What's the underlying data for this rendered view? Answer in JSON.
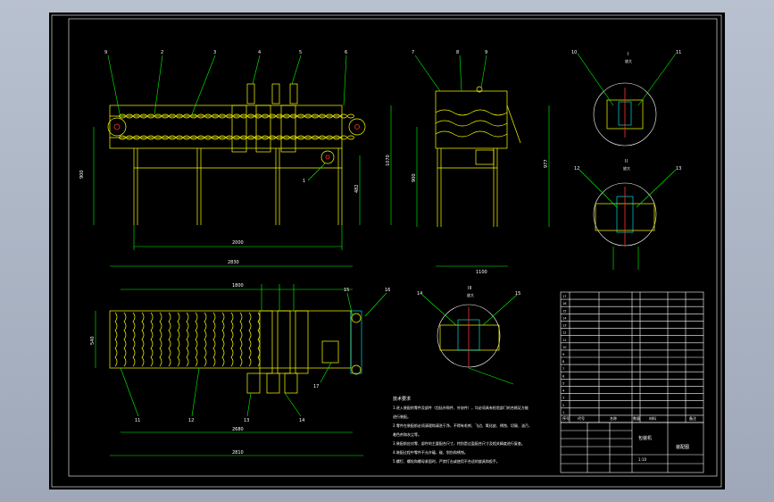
{
  "colors": {
    "sheet": "#000000",
    "frame": "#ffffff",
    "part": "#ffff00",
    "dim": "#00ff00",
    "center": "#ff3030",
    "hidden": "#00ffff"
  },
  "front_view": {
    "balloons": [
      "9",
      "2",
      "3",
      "4",
      "5",
      "6",
      "1"
    ],
    "dims": {
      "overall": "2830",
      "inner": "2000",
      "height_left": "900",
      "height_right": "850",
      "height_mid": "482",
      "height_top": "1070"
    }
  },
  "side_view": {
    "balloons": [
      "7",
      "8",
      "9"
    ],
    "dims": {
      "height": "977",
      "width": "1100",
      "height_left": "900"
    }
  },
  "detail_a": {
    "title": "I",
    "subtitle": "放大",
    "balloons": [
      "10",
      "11"
    ]
  },
  "detail_b": {
    "title": "II",
    "subtitle": "放大",
    "balloons": [
      "12",
      "13"
    ]
  },
  "detail_c": {
    "title": "III",
    "subtitle": "放大",
    "balloons": [
      "14",
      "15"
    ]
  },
  "top_view": {
    "balloons": [
      "11",
      "12",
      "13",
      "14",
      "15",
      "16",
      "17"
    ],
    "dims": {
      "length": "1800",
      "total": "2680",
      "overall": "2810",
      "width": "540"
    }
  },
  "tech_requirements": {
    "title": "技术要求",
    "lines": [
      "1.进入装配的零件及部件（包括外购件、外协件），均必须具有检验部门的合格证方能",
      "进行装配。",
      "2.零件在装配前必须清理和清洗干净，不得有毛刺、飞边、氧化皮、锈蚀、切屑、油污、",
      "着色剂和灰尘等。",
      "3.装配前应对零、部件的主要配合尺寸，特别是过盈配合尺寸及相关精度进行复查。",
      "4.装配过程中零件不允许磕、碰、划伤和锈蚀。",
      "5.螺钉、螺栓和螺母紧固时，严禁打击或使用不合适的旋具和扳手。"
    ]
  },
  "bom": {
    "header": [
      "序号",
      "代号",
      "名称",
      "数量",
      "材料",
      "备注"
    ],
    "rows_count_text": [
      "17",
      "16",
      "15",
      "14",
      "13",
      "12",
      "11",
      "10",
      "9",
      "8",
      "7",
      "6",
      "5",
      "4",
      "3",
      "2",
      "1"
    ]
  },
  "title_block": {
    "title": "包装机",
    "drawing_no": "装配图",
    "scale": "1:10"
  }
}
